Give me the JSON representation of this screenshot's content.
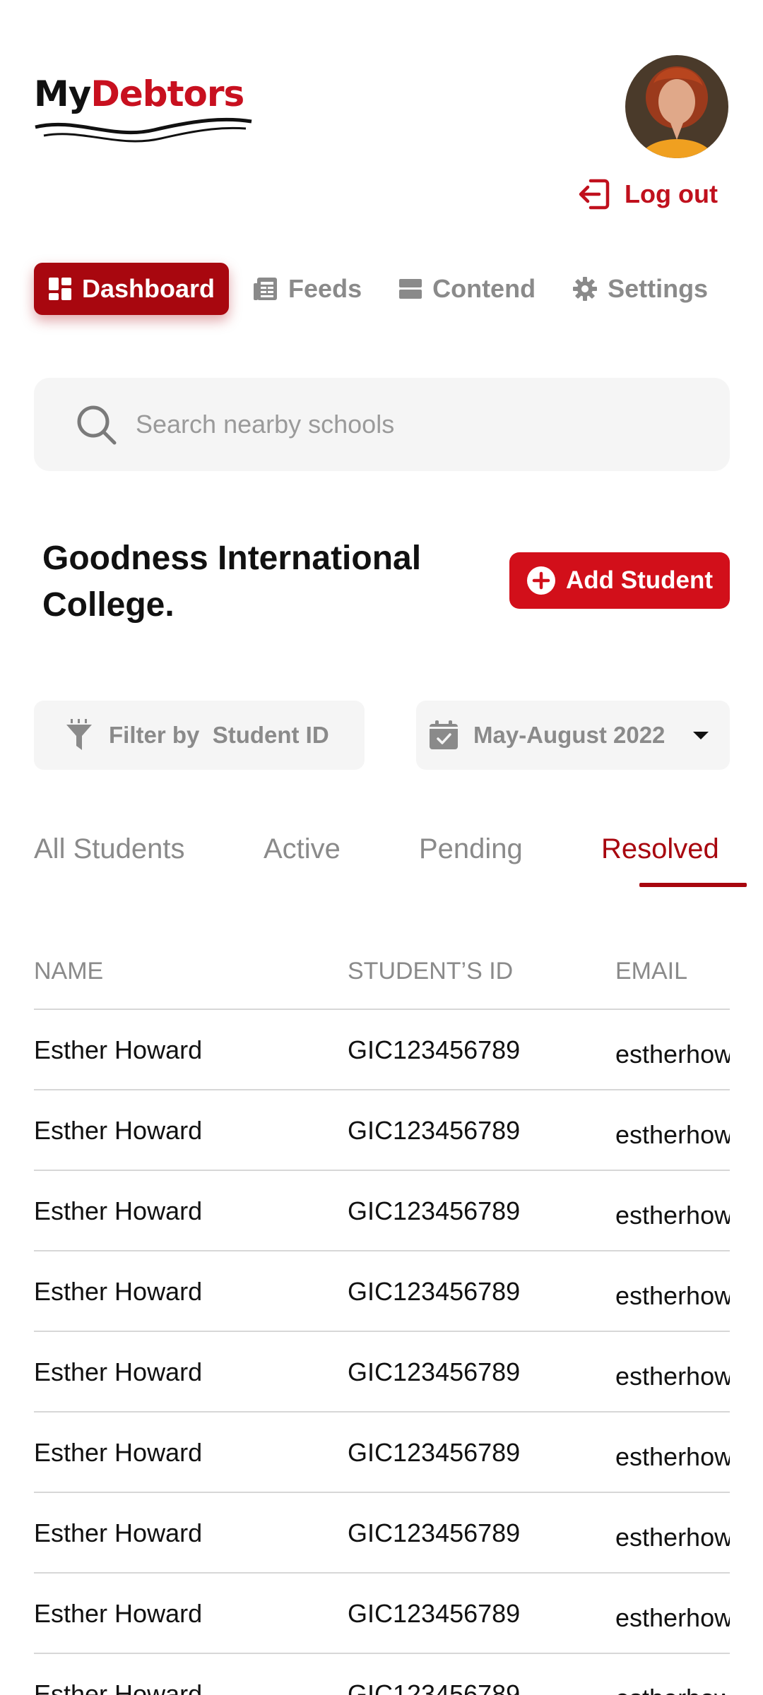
{
  "brand": {
    "logo_prefix": "My",
    "logo_suffix": "Debtors",
    "accent": "#c8101f"
  },
  "header": {
    "logout_label": "Log out",
    "avatar": "user-avatar"
  },
  "nav": {
    "items": [
      {
        "label": "Dashboard",
        "icon": "dashboard-icon",
        "active": true
      },
      {
        "label": "Feeds",
        "icon": "feeds-icon"
      },
      {
        "label": "Contend",
        "icon": "contend-icon"
      },
      {
        "label": "Settings",
        "icon": "gear-icon"
      }
    ]
  },
  "search": {
    "placeholder": "Search nearby schools",
    "value": ""
  },
  "school": {
    "name": "Goodness International College."
  },
  "actions": {
    "add_student_label": "Add Student"
  },
  "filters": {
    "filter_label": "Filter by  Student ID",
    "date_range": "May-August 2022"
  },
  "tabs": {
    "items": [
      {
        "label": "All Students"
      },
      {
        "label": "Active"
      },
      {
        "label": "Pending"
      },
      {
        "label": "Resolved",
        "active": true
      }
    ]
  },
  "table": {
    "columns": [
      "NAME",
      "STUDENT’S ID",
      "EMAIL"
    ],
    "rows": [
      {
        "name": "Esther Howard",
        "id": "GIC123456789",
        "email": "estherhow"
      },
      {
        "name": "Esther Howard",
        "id": "GIC123456789",
        "email": "estherhow"
      },
      {
        "name": "Esther Howard",
        "id": "GIC123456789",
        "email": "estherhow"
      },
      {
        "name": "Esther Howard",
        "id": "GIC123456789",
        "email": "estherhow"
      },
      {
        "name": "Esther Howard",
        "id": "GIC123456789",
        "email": "estherhow"
      },
      {
        "name": "Esther Howard",
        "id": "GIC123456789",
        "email": "estherhow"
      },
      {
        "name": "Esther Howard",
        "id": "GIC123456789",
        "email": "estherhow"
      },
      {
        "name": "Esther Howard",
        "id": "GIC123456789",
        "email": "estherhow"
      },
      {
        "name": "Esther Howard",
        "id": "GIC123456789",
        "email": "estherhow"
      }
    ]
  }
}
